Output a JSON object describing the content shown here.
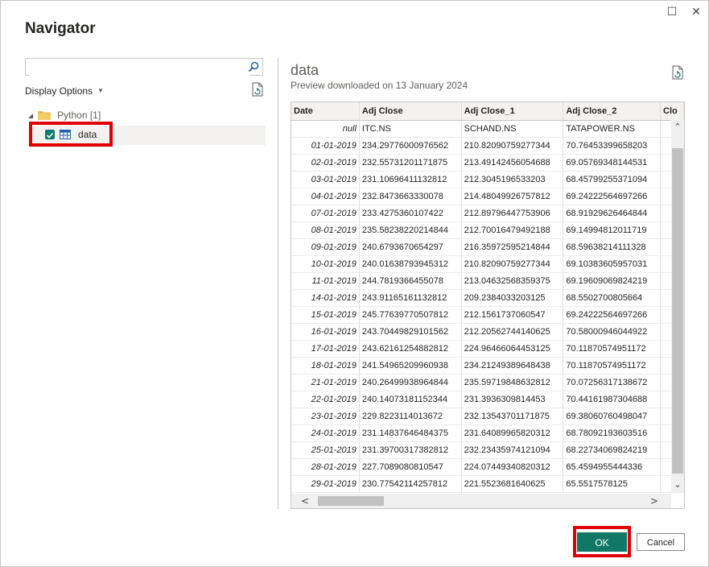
{
  "dialog": {
    "title": "Navigator",
    "maximize_glyph": "☐",
    "close_glyph": "✕"
  },
  "left_panel": {
    "search": {
      "value": "",
      "placeholder": "",
      "icon": "search-icon"
    },
    "display_options_label": "Display Options",
    "refresh_icon": "refresh-icon",
    "tree": {
      "folder_label": "Python [1]",
      "items": [
        {
          "label": "data",
          "checked": true,
          "icon": "table-icon"
        }
      ]
    }
  },
  "preview": {
    "title": "data",
    "subtitle": "Preview downloaded on 13 January 2024",
    "columns": [
      "Date",
      "Adj Close",
      "Adj Close_1",
      "Adj Close_2",
      "Clo"
    ],
    "subheader": [
      "null",
      "ITC.NS",
      "SCHAND.NS",
      "TATAPOWER.NS",
      ""
    ],
    "rows": [
      [
        "01-01-2019",
        "234.29776000976562",
        "210.82090759277344",
        "70.76453399658203",
        ""
      ],
      [
        "02-01-2019",
        "232.55731201171875",
        "213.49142456054688",
        "69.05769348144531",
        ""
      ],
      [
        "03-01-2019",
        "231.10696411132812",
        "212.3045196533203",
        "68.45799255371094",
        ""
      ],
      [
        "04-01-2019",
        "232.8473663330078",
        "214.48049926757812",
        "69.24222564697266",
        ""
      ],
      [
        "07-01-2019",
        "233.4275360107422",
        "212.89796447753906",
        "68.91929626464844",
        ""
      ],
      [
        "08-01-2019",
        "235.58238220214844",
        "212.70016479492188",
        "69.14994812011719",
        ""
      ],
      [
        "09-01-2019",
        "240.6793670654297",
        "216.35972595214844",
        "68.59638214111328",
        ""
      ],
      [
        "10-01-2019",
        "240.01638793945312",
        "210.82090759277344",
        "69.10383605957031",
        ""
      ],
      [
        "11-01-2019",
        "244.7819366455078",
        "213.04632568359375",
        "69.19609069824219",
        ""
      ],
      [
        "14-01-2019",
        "243.91165161132812",
        "209.2384033203125",
        "68.5502700805664",
        ""
      ],
      [
        "15-01-2019",
        "245.77639770507812",
        "212.1561737060547",
        "69.24222564697266",
        ""
      ],
      [
        "16-01-2019",
        "243.70449829101562",
        "212.20562744140625",
        "70.58000946044922",
        ""
      ],
      [
        "17-01-2019",
        "243.62161254882812",
        "224.96466064453125",
        "70.11870574951172",
        ""
      ],
      [
        "18-01-2019",
        "241.54965209960938",
        "234.21249389648438",
        "70.11870574951172",
        ""
      ],
      [
        "21-01-2019",
        "240.26499938964844",
        "235.59719848632812",
        "70.07256317138672",
        ""
      ],
      [
        "22-01-2019",
        "240.14073181152344",
        "231.3936309814453",
        "70.44161987304688",
        ""
      ],
      [
        "23-01-2019",
        "229.8223114013672",
        "232.13543701171875",
        "69.38060760498047",
        ""
      ],
      [
        "24-01-2019",
        "231.14837646484375",
        "231.64089965820312",
        "68.78092193603516",
        ""
      ],
      [
        "25-01-2019",
        "231.39700317382812",
        "232.23435974121094",
        "68.22734069824219",
        ""
      ],
      [
        "28-01-2019",
        "227.7089080810547",
        "224.07449340820312",
        "65.4594955444336",
        ""
      ],
      [
        "29-01-2019",
        "230.77542114257812",
        "221.5523681640625",
        "65.5517578125",
        ""
      ]
    ]
  },
  "footer": {
    "ok_label": "OK",
    "cancel_label": "Cancel"
  },
  "colors": {
    "accent": "#117865",
    "highlight": "#e00000"
  }
}
